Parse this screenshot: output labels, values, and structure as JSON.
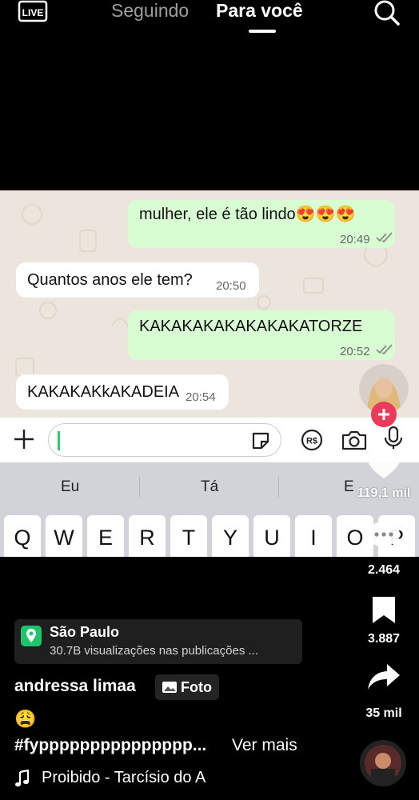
{
  "top_nav": {
    "live_icon": "live-tv-icon",
    "tabs": [
      {
        "label": "Seguindo",
        "active": false
      },
      {
        "label": "Para você",
        "active": true
      }
    ],
    "search_icon": "search-icon"
  },
  "chat": {
    "messages": [
      {
        "direction": "out",
        "text": "mulher, ele é tão lindo😍😍😍",
        "time": "20:49",
        "read": true
      },
      {
        "direction": "in",
        "text": "Quantos anos ele tem?",
        "time": "20:50"
      },
      {
        "direction": "out",
        "text": "KAKAKAKAKAKAKAKATORZE",
        "time": "20:52",
        "read": true
      },
      {
        "direction": "in",
        "text": "KAKAKAKkAKADEIA",
        "time": "20:54"
      }
    ],
    "input": {
      "value": "",
      "placeholder": ""
    },
    "colors": {
      "outgoing": "#d9fdd3",
      "incoming": "#ffffff",
      "accent": "#25d366"
    }
  },
  "keyboard": {
    "suggestions": [
      "Eu",
      "Tá",
      "E"
    ],
    "row1": [
      "Q",
      "W",
      "E",
      "R",
      "T",
      "Y",
      "U",
      "I",
      "O",
      "P"
    ]
  },
  "rail": {
    "likes": "119,1 mil",
    "comments": "2.464",
    "saves": "3.887",
    "shares": "35 mil",
    "follow_color": "#ea3b5c"
  },
  "caption": {
    "location_name": "São Paulo",
    "location_sub": "30.7B visualizações nas publicações ...",
    "username": "andressa limaa",
    "badge": "Foto",
    "emoji": "😩",
    "hashtags": "#fyppppppppppppppp...",
    "see_more": "Ver mais",
    "song": "Proibido - Tarcísio do A"
  }
}
